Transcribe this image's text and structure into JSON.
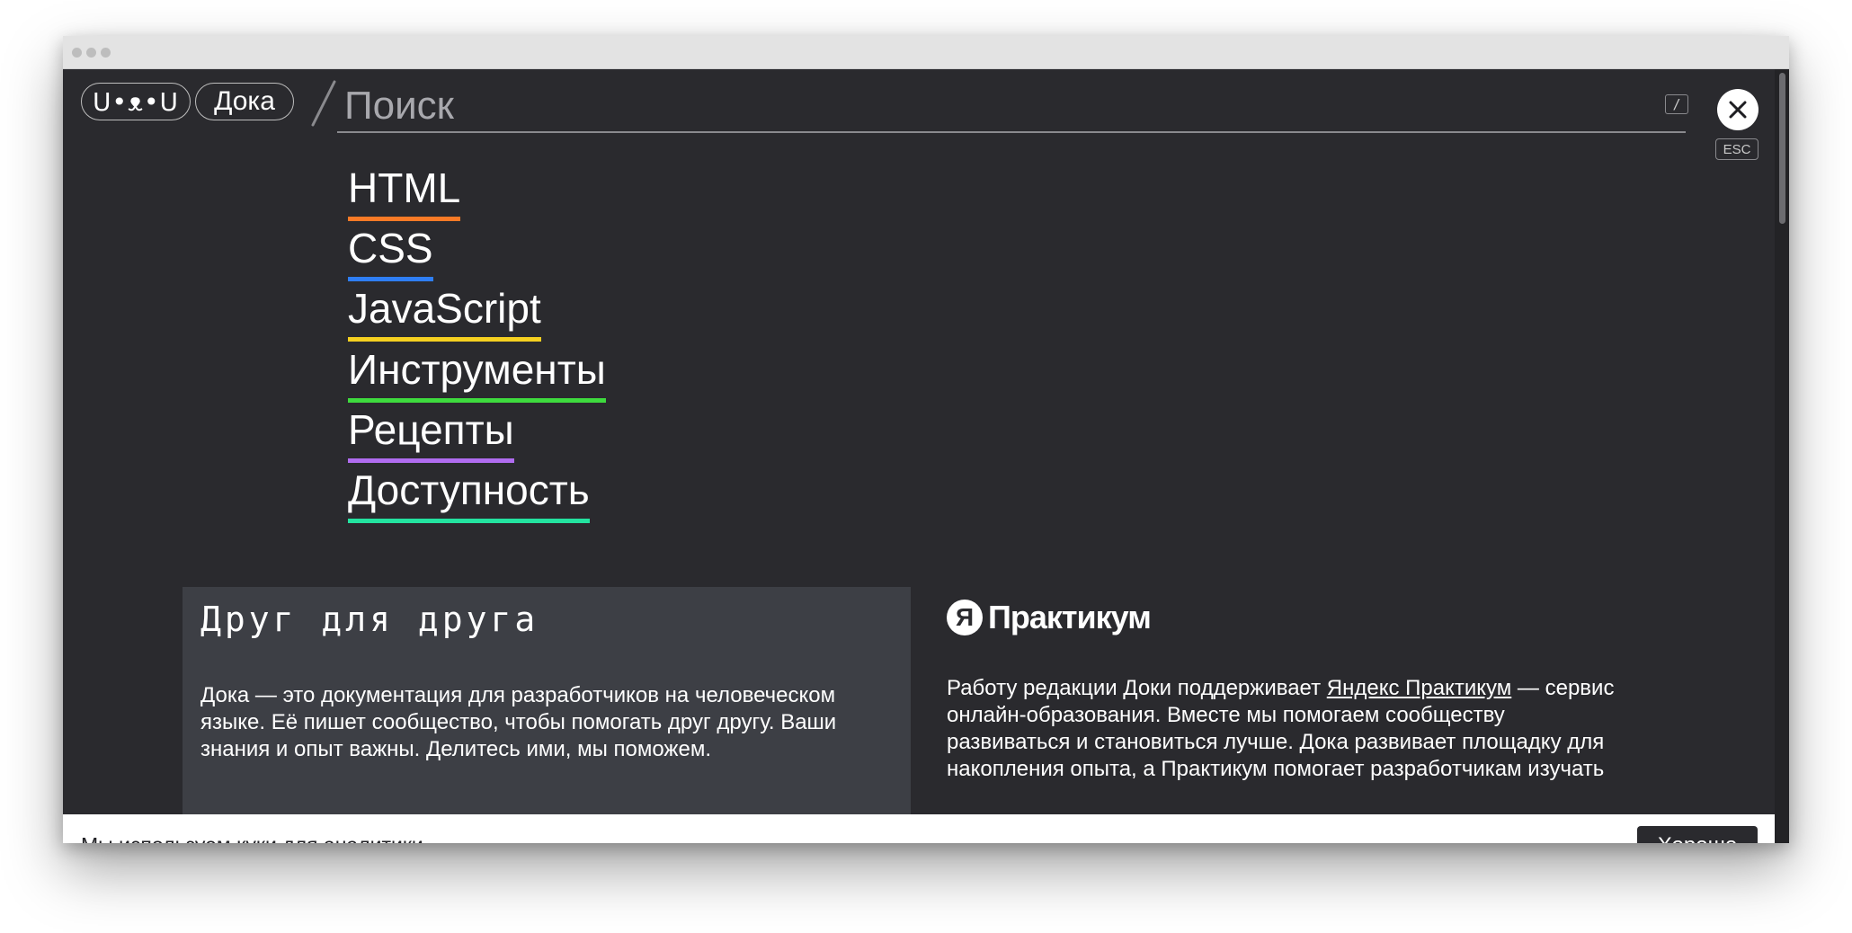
{
  "header": {
    "logo_face": "U•ᴥ•U",
    "logo_text": "Дока",
    "search_placeholder": "Поиск",
    "search_shortcut": "/",
    "close_label": "ESC"
  },
  "sections": [
    {
      "label": "HTML",
      "color": "#f97a26"
    },
    {
      "label": "CSS",
      "color": "#2f7ef5"
    },
    {
      "label": "JavaScript",
      "color": "#f5d020"
    },
    {
      "label": "Инструменты",
      "color": "#3edb3e"
    },
    {
      "label": "Рецепты",
      "color": "#b06cf0"
    },
    {
      "label": "Доступность",
      "color": "#23e3a0"
    }
  ],
  "about": {
    "title": "Друг для друга",
    "text": "Дока — это документация для разработчиков на человеческом языке. Её пишет сообщество, чтобы помогать друг другу. Ваши знания и опыт важны. Делитесь ими, мы поможем."
  },
  "practicum": {
    "badge": "Я",
    "name": "Практикум",
    "text_before": "Работу редакции Доки поддерживает ",
    "link": "Яндекс Практикум",
    "text_after": " — сервис онлайн-образования. Вместе мы помогаем сообществу развиваться и становиться лучше. Дока развивает площадку для накопления опыта, а Практикум помогает разработчикам изучать"
  },
  "cookie": {
    "text": "Мы используем куки для аналитики",
    "button": "Хорошо"
  }
}
